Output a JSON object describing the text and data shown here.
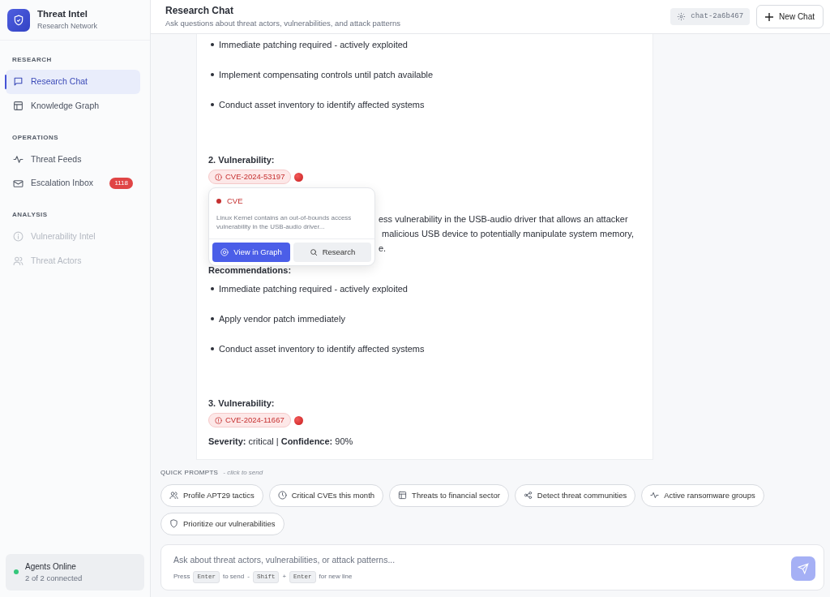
{
  "brand": {
    "title": "Threat Intel",
    "subtitle": "Research Network"
  },
  "sidebar": {
    "sections": [
      {
        "heading": "RESEARCH",
        "items": [
          {
            "label": "Research Chat",
            "selected": true,
            "disabled": false
          },
          {
            "label": "Knowledge Graph",
            "selected": false,
            "disabled": false
          }
        ]
      },
      {
        "heading": "OPERATIONS",
        "items": [
          {
            "label": "Threat Feeds",
            "selected": false,
            "disabled": false
          },
          {
            "label": "Escalation Inbox",
            "selected": false,
            "disabled": false,
            "badge": "1118"
          }
        ]
      },
      {
        "heading": "ANALYSIS",
        "items": [
          {
            "label": "Vulnerability Intel",
            "selected": false,
            "disabled": true
          },
          {
            "label": "Threat Actors",
            "selected": false,
            "disabled": true
          }
        ]
      }
    ],
    "status": {
      "title": "Agents Online",
      "detail": "2 of 2 connected",
      "online": true
    }
  },
  "header": {
    "title": "Research Chat",
    "subtitle": "Ask questions about threat actors, vulnerabilities, and attack patterns",
    "session": "chat-2a6b467",
    "new_chat": "New Chat"
  },
  "message": {
    "blocks": [
      {
        "kind": "bullet",
        "text": "Immediate patching required - actively exploited"
      },
      {
        "kind": "bullet",
        "text": "Implement compensating controls until patch available"
      },
      {
        "kind": "bullet",
        "text": "Conduct asset inventory to identify affected systems"
      },
      {
        "kind": "heading",
        "text": "2. Vulnerability:"
      },
      {
        "kind": "chip",
        "text": "CVE-2024-53197",
        "popover": {
          "type": "CVE",
          "summary": "Linux Kernel contains an out-of-bounds access vulnerability in the USB-audio driver...",
          "actions": [
            {
              "label": "View in Graph",
              "kind": "primary"
            },
            {
              "label": "Research",
              "kind": "secondary"
            }
          ]
        }
      },
      {
        "kind": "covered",
        "lines": [
          "ess vulnerability in the USB-audio driver that allows an attacker",
          "malicious USB device to potentially manipulate system memory,",
          "e."
        ]
      },
      {
        "kind": "label",
        "text": "Recommendations:"
      },
      {
        "kind": "bullet",
        "text": "Immediate patching required - actively exploited"
      },
      {
        "kind": "bullet",
        "text": "Apply vendor patch immediately"
      },
      {
        "kind": "bullet",
        "text": "Conduct asset inventory to identify affected systems"
      },
      {
        "kind": "heading",
        "text": "3. Vulnerability:"
      },
      {
        "kind": "chip",
        "text": "CVE-2024-11667"
      },
      {
        "kind": "para",
        "text": "**Severity:** critical | **Confidence:** 90%"
      }
    ]
  },
  "quick_prompts": {
    "title": "QUICK PROMPTS",
    "hint": "- click to send",
    "items": [
      {
        "label": "Profile APT29 tactics"
      },
      {
        "label": "Critical CVEs this month"
      },
      {
        "label": "Threats to financial sector"
      },
      {
        "label": "Detect threat communities"
      },
      {
        "label": "Active ransomware groups"
      },
      {
        "label": "Prioritize our vulnerabilities"
      }
    ]
  },
  "composer": {
    "placeholder": "Ask about threat actors, vulnerabilities, or attack patterns...",
    "hint_parts": [
      {
        "kind": "text",
        "text": "Press"
      },
      {
        "kind": "key",
        "text": "Enter"
      },
      {
        "kind": "text",
        "text": "to send"
      },
      {
        "kind": "text",
        "text": "-"
      },
      {
        "kind": "key",
        "text": "Shift"
      },
      {
        "kind": "text",
        "text": "+"
      },
      {
        "kind": "key",
        "text": "Enter"
      },
      {
        "kind": "text",
        "text": "for new line"
      }
    ]
  }
}
